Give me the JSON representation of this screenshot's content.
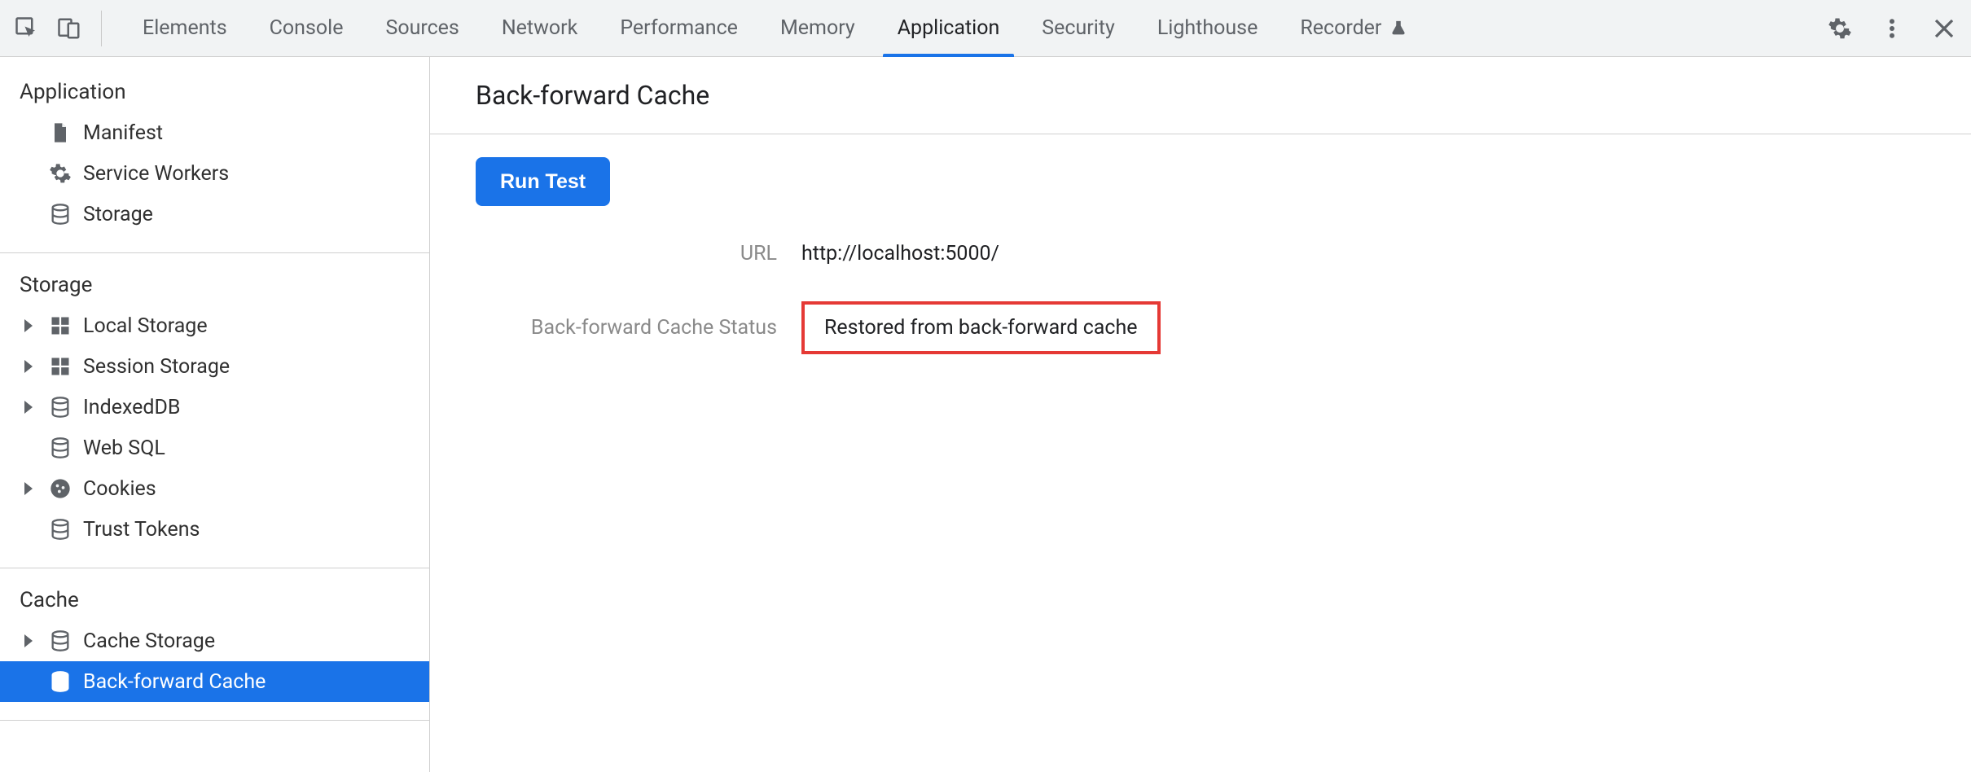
{
  "tabs": {
    "items": [
      {
        "label": "Elements"
      },
      {
        "label": "Console"
      },
      {
        "label": "Sources"
      },
      {
        "label": "Network"
      },
      {
        "label": "Performance"
      },
      {
        "label": "Memory"
      },
      {
        "label": "Application"
      },
      {
        "label": "Security"
      },
      {
        "label": "Lighthouse"
      },
      {
        "label": "Recorder"
      }
    ],
    "active_index": 6
  },
  "sidebar": {
    "sections": [
      {
        "title": "Application",
        "items": [
          {
            "label": "Manifest",
            "icon": "file-icon",
            "chevron": false,
            "selected": false
          },
          {
            "label": "Service Workers",
            "icon": "gear-icon",
            "chevron": false,
            "selected": false
          },
          {
            "label": "Storage",
            "icon": "db-icon",
            "chevron": false,
            "selected": false
          }
        ]
      },
      {
        "title": "Storage",
        "items": [
          {
            "label": "Local Storage",
            "icon": "grid-icon",
            "chevron": true,
            "selected": false
          },
          {
            "label": "Session Storage",
            "icon": "grid-icon",
            "chevron": true,
            "selected": false
          },
          {
            "label": "IndexedDB",
            "icon": "db-icon",
            "chevron": true,
            "selected": false
          },
          {
            "label": "Web SQL",
            "icon": "db-icon",
            "chevron": false,
            "selected": false
          },
          {
            "label": "Cookies",
            "icon": "cookie-icon",
            "chevron": true,
            "selected": false
          },
          {
            "label": "Trust Tokens",
            "icon": "db-icon",
            "chevron": false,
            "selected": false
          }
        ]
      },
      {
        "title": "Cache",
        "items": [
          {
            "label": "Cache Storage",
            "icon": "db-icon",
            "chevron": true,
            "selected": false
          },
          {
            "label": "Back-forward Cache",
            "icon": "db-icon",
            "chevron": false,
            "selected": true
          }
        ]
      }
    ]
  },
  "page": {
    "title": "Back-forward Cache",
    "run_button": "Run Test",
    "url_label": "URL",
    "url_value": "http://localhost:5000/",
    "status_label": "Back-forward Cache Status",
    "status_value": "Restored from back-forward cache"
  }
}
